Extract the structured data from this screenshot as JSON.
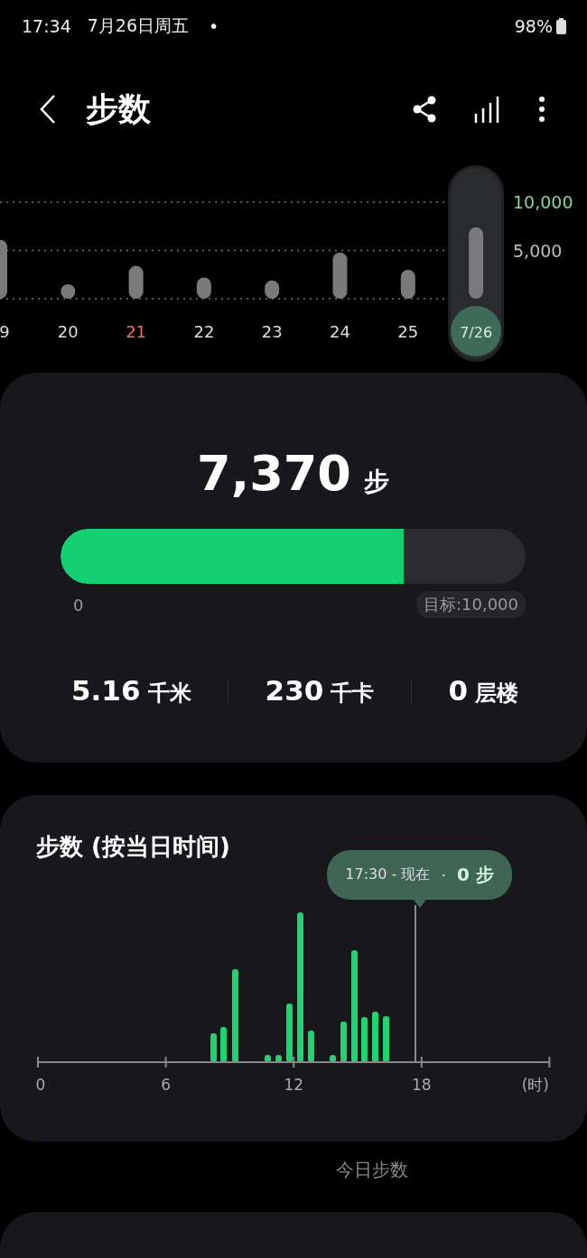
{
  "status_bar": {
    "time": "17:34",
    "date": "7月26日周五",
    "dot": "•",
    "battery": "98%"
  },
  "header": {
    "title": "步数"
  },
  "week_chart": {
    "chart_data": {
      "type": "bar",
      "categories": [
        "9",
        "20",
        "21",
        "22",
        "23",
        "24",
        "25",
        "7/26"
      ],
      "values": [
        6100,
        1500,
        3400,
        2200,
        1900,
        4800,
        3000,
        7400
      ],
      "ylim": [
        0,
        10000
      ],
      "yticks": [
        {
          "value": 5000,
          "label": "5,000"
        },
        {
          "value": 10000,
          "label": "10,000"
        }
      ]
    },
    "days": [
      {
        "selected": false,
        "sunday": false
      },
      {
        "selected": false,
        "sunday": false
      },
      {
        "selected": false,
        "sunday": true
      },
      {
        "selected": false,
        "sunday": false
      },
      {
        "selected": false,
        "sunday": false
      },
      {
        "selected": false,
        "sunday": false
      },
      {
        "selected": false,
        "sunday": false
      },
      {
        "selected": true,
        "sunday": false
      }
    ]
  },
  "summary": {
    "steps": "7,370",
    "unit": "步",
    "level": 0.737,
    "min_label": "0",
    "goal_label": "目标:10,000",
    "stats": [
      {
        "value": "5.16",
        "unit": "千米"
      },
      {
        "value": "230",
        "unit": "千卡"
      },
      {
        "value": "0",
        "unit": "层楼"
      }
    ]
  },
  "hourly": {
    "title": "步数 (按当日时间)",
    "tooltip": {
      "time": "17:30 - 现在",
      "separator": "·",
      "value": "0 步"
    },
    "axis_labels": [
      "0",
      "6",
      "12",
      "18"
    ],
    "axis_unit": "(时)"
  },
  "caption": "今日步数"
}
